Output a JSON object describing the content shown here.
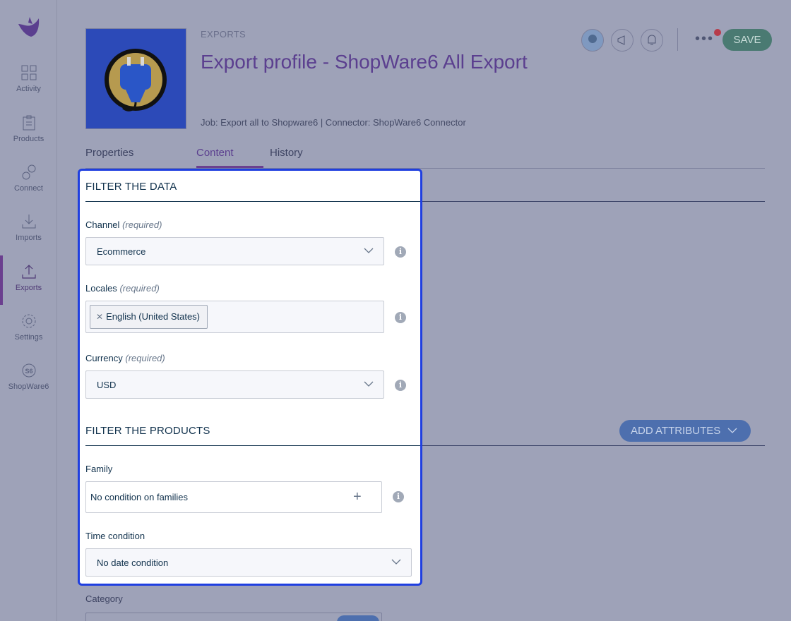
{
  "sidebar": {
    "items": [
      {
        "label": "Activity",
        "icon": "dashboard-icon"
      },
      {
        "label": "Products",
        "icon": "clipboard-icon"
      },
      {
        "label": "Connect",
        "icon": "link-icon"
      },
      {
        "label": "Imports",
        "icon": "import-icon"
      },
      {
        "label": "Exports",
        "icon": "export-icon",
        "active": true
      },
      {
        "label": "Settings",
        "icon": "gear-icon"
      },
      {
        "label": "ShopWare6",
        "icon": "shopware6-icon"
      }
    ]
  },
  "header": {
    "breadcrumb": "EXPORTS",
    "title": "Export profile - ShopWare6 All Export",
    "meta": "Job: Export all to Shopware6 | Connector: ShopWare6 Connector",
    "save_label": "SAVE",
    "more_label": "•••"
  },
  "tabs": [
    {
      "label": "Properties"
    },
    {
      "label": "Content",
      "active": true
    },
    {
      "label": "History"
    }
  ],
  "panel": {
    "filter_data_title": "FILTER THE DATA",
    "channel": {
      "label": "Channel",
      "hint": "(required)",
      "value": "Ecommerce"
    },
    "locales": {
      "label": "Locales",
      "hint": "(required)",
      "chips": [
        "English (United States)"
      ]
    },
    "currency": {
      "label": "Currency",
      "hint": "(required)",
      "value": "USD"
    },
    "filter_products_title": "FILTER THE PRODUCTS",
    "family": {
      "label": "Family",
      "value": "No condition on families"
    },
    "time": {
      "label": "Time condition",
      "value": "No date condition"
    }
  },
  "background": {
    "add_attributes_label": "ADD ATTRIBUTES",
    "category_label": "Category"
  },
  "colors": {
    "accent": "#6b3f8f",
    "highlight_border": "#1f3fe0",
    "save_bg": "#4a7a72"
  }
}
